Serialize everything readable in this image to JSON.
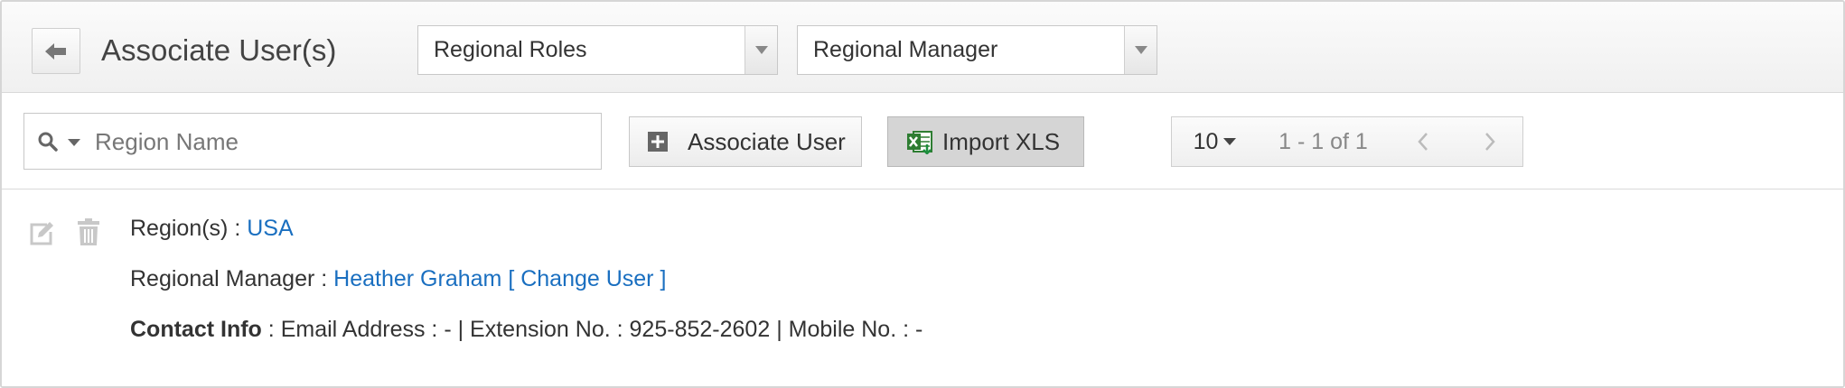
{
  "header": {
    "title": "Associate User(s)",
    "role_type_select": "Regional Roles",
    "role_select": "Regional Manager"
  },
  "toolbar": {
    "search_placeholder": "Region Name",
    "associate_label": "Associate User",
    "import_label": "Import XLS",
    "page_size": "10",
    "page_info": "1 - 1 of 1"
  },
  "record": {
    "region_label": "Region(s) :",
    "region_value": "USA",
    "manager_label": "Regional Manager :",
    "manager_value": "Heather Graham",
    "change_user_label": "[ Change User ]",
    "contact_label": "Contact Info",
    "contact_sep": ":",
    "email_label": "Email Address : -",
    "divider1": "|",
    "extension_label": "Extension No. :",
    "extension_value": "925-852-2602",
    "divider2": "|",
    "mobile_label": "Mobile No. : -"
  },
  "colors": {
    "link": "#1a6fc0",
    "header_bg": "#f4f4f4",
    "border": "#d6d6d6"
  },
  "icons": [
    "back-arrow-icon",
    "dropdown-arrow-icon",
    "search-icon",
    "caret-down-icon",
    "plus-icon",
    "excel-icon",
    "chevron-left-icon",
    "chevron-right-icon",
    "edit-icon",
    "trash-icon"
  ]
}
